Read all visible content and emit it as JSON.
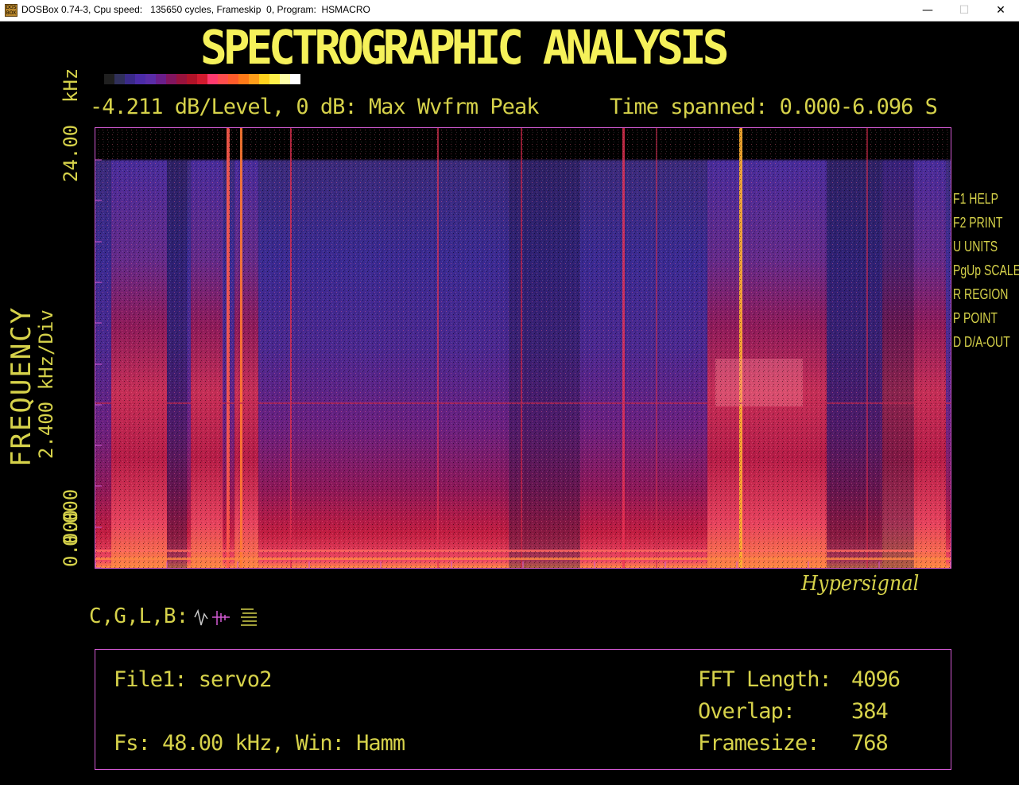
{
  "window": {
    "title": "DOSBox 0.74-3, Cpu speed:   135650 cycles, Frameskip  0, Program:  HSMACRO",
    "icon_text": "DOS BOX",
    "minimize": "—",
    "maximize": "☐",
    "close": "✕"
  },
  "header": {
    "title": "SPECTROGRAPHIC ANALYSIS",
    "scale_info": "-4.211 dB/Level, 0 dB: Max Wvfrm Peak",
    "time_spanned": "Time spanned: 0.000-6.096 S"
  },
  "palette_colors": [
    "#000000",
    "#202020",
    "#30305a",
    "#3a2a8a",
    "#4b2ba8",
    "#5a2ca8",
    "#6a1e8a",
    "#82155e",
    "#98123c",
    "#b01228",
    "#d21a2e",
    "#ff3a6e",
    "#ff4d4d",
    "#ff5b2a",
    "#ff7a18",
    "#ff9e1a",
    "#ffd21e",
    "#fff04a",
    "#ffffa8",
    "#ffffff"
  ],
  "y_axis": {
    "unit_label": "kHz",
    "top_value": "24.00",
    "title": "FREQUENCY",
    "div_label": "2.400 kHz/Div",
    "mid_value": "0.000",
    "bottom_value": "0.000"
  },
  "function_keys": [
    {
      "key": "F1",
      "label": "HELP"
    },
    {
      "key": "F2",
      "label": "PRINT"
    },
    {
      "key": "U",
      "label": "UNITS"
    },
    {
      "key": "PgUp",
      "label": "SCALE"
    },
    {
      "key": "R",
      "label": "REGION"
    },
    {
      "key": "P",
      "label": "POINT"
    },
    {
      "key": "D",
      "label": "D/A-OUT"
    }
  ],
  "brand": "Hypersignal",
  "display_modes": {
    "label": "C,G,L,B:",
    "icons": [
      "waveform-icon",
      "spectrum-lines-icon",
      "stacked-lines-icon"
    ]
  },
  "info": {
    "file": "File1: servo2",
    "fs": "Fs: 48.00 kHz, Win: Hamm",
    "fft_label": "FFT Length:",
    "fft_value": "4096",
    "overlap_label": "Overlap:",
    "overlap_value": "384",
    "framesize_label": "Framesize:",
    "framesize_value": "768"
  },
  "colors": {
    "text": "#d6d24a",
    "title": "#f5f15a",
    "border": "#d35ad3"
  }
}
